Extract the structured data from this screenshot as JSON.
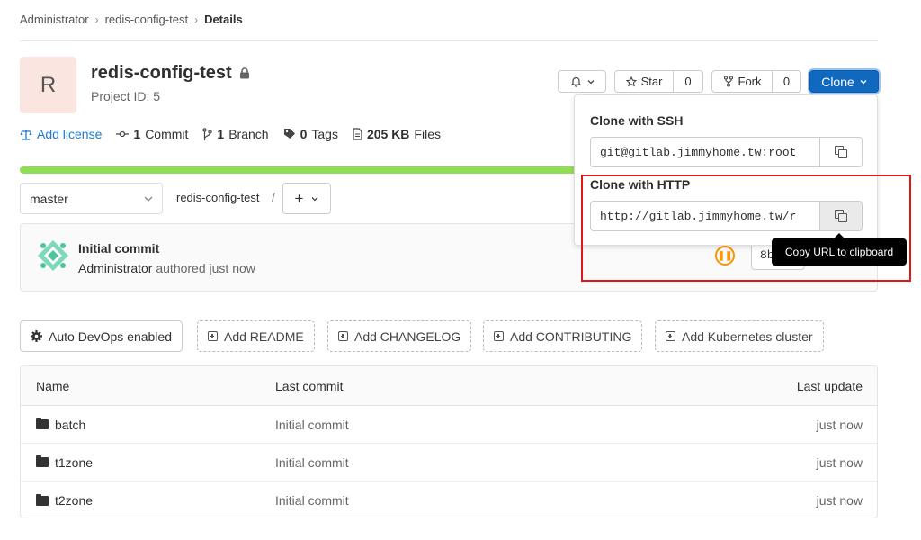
{
  "breadcrumb": {
    "items": [
      "Administrator",
      "redis-config-test"
    ],
    "current": "Details"
  },
  "project": {
    "avatar_letter": "R",
    "name": "redis-config-test",
    "id_label": "Project ID: 5"
  },
  "header_actions": {
    "star_label": "Star",
    "star_count": "0",
    "fork_label": "Fork",
    "fork_count": "0",
    "clone_label": "Clone"
  },
  "stats": {
    "add_license": "Add license",
    "commits_count": "1",
    "commits_label": "Commit",
    "branches_count": "1",
    "branches_label": "Branch",
    "tags_count": "0",
    "tags_label": "Tags",
    "files_size": "205 KB",
    "files_label": "Files"
  },
  "storage_progress": 0.8,
  "repo_nav": {
    "branch": "master",
    "path": "redis-config-test",
    "path_sep": "/",
    "add_label": "+"
  },
  "last_commit": {
    "title": "Initial commit",
    "author": "Administrator",
    "authored": "authored just now",
    "sha": "8b"
  },
  "quick_actions": [
    "Auto DevOps enabled",
    "Add README",
    "Add CHANGELOG",
    "Add CONTRIBUTING",
    "Add Kubernetes cluster"
  ],
  "file_table": {
    "headers": {
      "name": "Name",
      "last_commit": "Last commit",
      "last_update": "Last update"
    },
    "rows": [
      {
        "name": "batch",
        "last_commit": "Initial commit",
        "last_update": "just now"
      },
      {
        "name": "t1zone",
        "last_commit": "Initial commit",
        "last_update": "just now"
      },
      {
        "name": "t2zone",
        "last_commit": "Initial commit",
        "last_update": "just now"
      }
    ]
  },
  "clone_dropdown": {
    "ssh_label": "Clone with SSH",
    "ssh_url": "git@gitlab.jimmyhome.tw:root",
    "http_label": "Clone with HTTP",
    "http_url": "http://gitlab.jimmyhome.tw/r"
  },
  "tooltip": "Copy URL to clipboard",
  "colors": {
    "accent": "#1068bf",
    "progress": "#8fde55",
    "pipeline_running": "#fc9403",
    "highlight": "#e0161b"
  }
}
